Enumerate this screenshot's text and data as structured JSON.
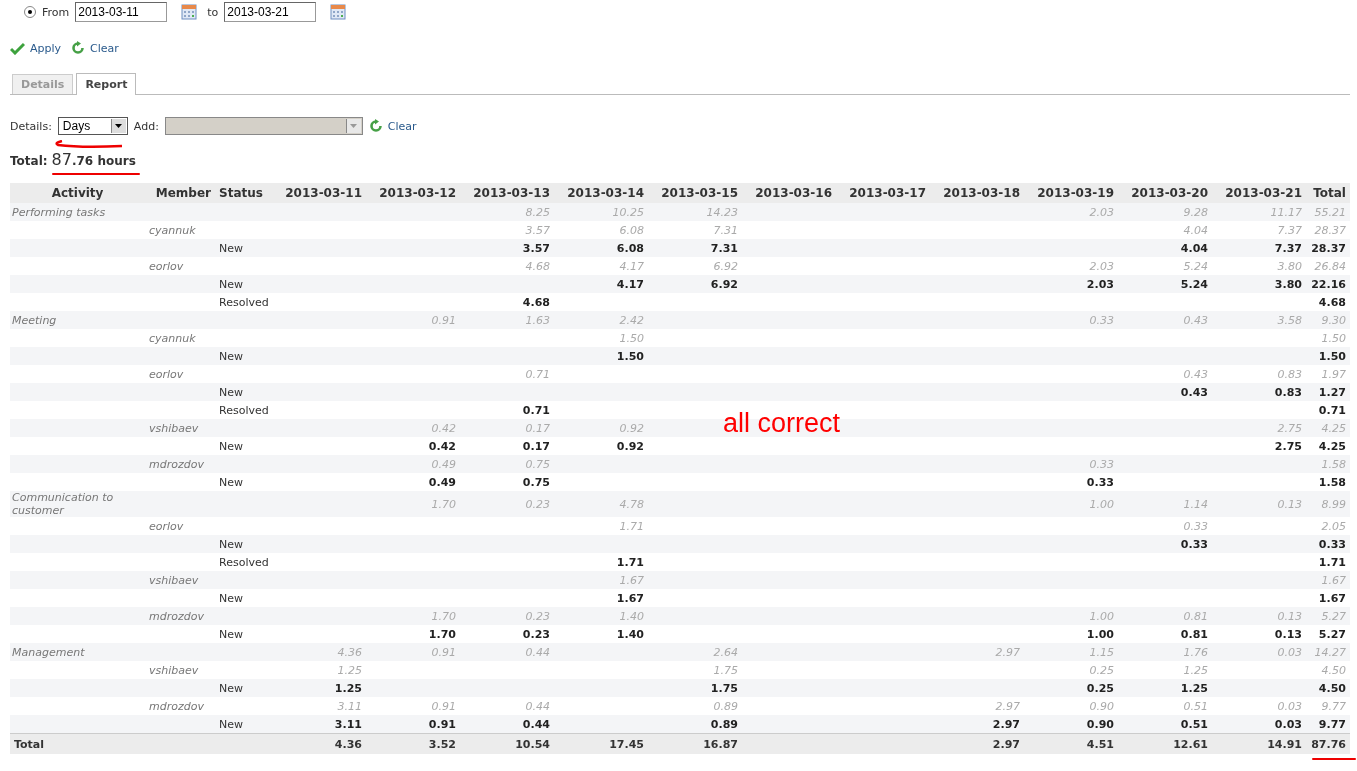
{
  "period": {
    "selected": true,
    "from_label": "From",
    "from": "2013-03-11",
    "to_label": "to",
    "to": "2013-03-21"
  },
  "actions": [
    {
      "kind": "apply",
      "label": "Apply"
    },
    {
      "kind": "clear",
      "label": "Clear"
    }
  ],
  "tabs": [
    {
      "label": "Details",
      "selected": false
    },
    {
      "label": "Report",
      "selected": true
    }
  ],
  "controls": {
    "details_label": "Details:",
    "details_value": "Days",
    "add_label": "Add:",
    "clear": "Clear"
  },
  "total": {
    "label": "Total:",
    "value": "87",
    "rest": ".76 hours"
  },
  "annotation": "all correct",
  "table": {
    "columns": [
      "Activity",
      "Member",
      "Status",
      "2013-03-11",
      "2013-03-12",
      "2013-03-13",
      "2013-03-14",
      "2013-03-15",
      "2013-03-16",
      "2013-03-17",
      "2013-03-18",
      "2013-03-19",
      "2013-03-20",
      "2013-03-21",
      "Total"
    ],
    "rows": [
      {
        "kind": "activity",
        "cells": [
          "Performing tasks",
          "",
          "",
          "",
          "",
          "8.25",
          "10.25",
          "14.23",
          "",
          "",
          "",
          "2.03",
          "9.28",
          "11.17",
          "55.21"
        ]
      },
      {
        "kind": "member",
        "cells": [
          "",
          "cyannuk",
          "",
          "",
          "",
          "3.57",
          "6.08",
          "7.31",
          "",
          "",
          "",
          "",
          "4.04",
          "7.37",
          "28.37"
        ]
      },
      {
        "kind": "status",
        "cells": [
          "",
          "",
          "New",
          "",
          "",
          "3.57",
          "6.08",
          "7.31",
          "",
          "",
          "",
          "",
          "4.04",
          "7.37",
          "28.37"
        ]
      },
      {
        "kind": "member",
        "cells": [
          "",
          "eorlov",
          "",
          "",
          "",
          "4.68",
          "4.17",
          "6.92",
          "",
          "",
          "",
          "2.03",
          "5.24",
          "3.80",
          "26.84"
        ]
      },
      {
        "kind": "status",
        "cells": [
          "",
          "",
          "New",
          "",
          "",
          "",
          "4.17",
          "6.92",
          "",
          "",
          "",
          "2.03",
          "5.24",
          "3.80",
          "22.16"
        ]
      },
      {
        "kind": "status",
        "cells": [
          "",
          "",
          "Resolved",
          "",
          "",
          "4.68",
          "",
          "",
          "",
          "",
          "",
          "",
          "",
          "",
          "4.68"
        ]
      },
      {
        "kind": "activity",
        "cells": [
          "Meeting",
          "",
          "",
          "",
          "0.91",
          "1.63",
          "2.42",
          "",
          "",
          "",
          "",
          "0.33",
          "0.43",
          "3.58",
          "9.30"
        ]
      },
      {
        "kind": "member",
        "cells": [
          "",
          "cyannuk",
          "",
          "",
          "",
          "",
          "1.50",
          "",
          "",
          "",
          "",
          "",
          "",
          "",
          "1.50"
        ]
      },
      {
        "kind": "status",
        "cells": [
          "",
          "",
          "New",
          "",
          "",
          "",
          "1.50",
          "",
          "",
          "",
          "",
          "",
          "",
          "",
          "1.50"
        ]
      },
      {
        "kind": "member",
        "cells": [
          "",
          "eorlov",
          "",
          "",
          "",
          "0.71",
          "",
          "",
          "",
          "",
          "",
          "",
          "0.43",
          "0.83",
          "1.97"
        ]
      },
      {
        "kind": "status",
        "cells": [
          "",
          "",
          "New",
          "",
          "",
          "",
          "",
          "",
          "",
          "",
          "",
          "",
          "0.43",
          "0.83",
          "1.27"
        ]
      },
      {
        "kind": "status",
        "cells": [
          "",
          "",
          "Resolved",
          "",
          "",
          "0.71",
          "",
          "",
          "",
          "",
          "",
          "",
          "",
          "",
          "0.71"
        ]
      },
      {
        "kind": "member",
        "cells": [
          "",
          "vshibaev",
          "",
          "",
          "0.42",
          "0.17",
          "0.92",
          "",
          "",
          "",
          "",
          "",
          "",
          "2.75",
          "4.25"
        ]
      },
      {
        "kind": "status",
        "cells": [
          "",
          "",
          "New",
          "",
          "0.42",
          "0.17",
          "0.92",
          "",
          "",
          "",
          "",
          "",
          "",
          "2.75",
          "4.25"
        ]
      },
      {
        "kind": "member",
        "cells": [
          "",
          "mdrozdov",
          "",
          "",
          "0.49",
          "0.75",
          "",
          "",
          "",
          "",
          "",
          "0.33",
          "",
          "",
          "1.58"
        ]
      },
      {
        "kind": "status",
        "cells": [
          "",
          "",
          "New",
          "",
          "0.49",
          "0.75",
          "",
          "",
          "",
          "",
          "",
          "0.33",
          "",
          "",
          "1.58"
        ]
      },
      {
        "kind": "activity",
        "cells": [
          "Communication to customer",
          "",
          "",
          "",
          "1.70",
          "0.23",
          "4.78",
          "",
          "",
          "",
          "",
          "1.00",
          "1.14",
          "0.13",
          "8.99"
        ]
      },
      {
        "kind": "member",
        "cells": [
          "",
          "eorlov",
          "",
          "",
          "",
          "",
          "1.71",
          "",
          "",
          "",
          "",
          "",
          "0.33",
          "",
          "2.05"
        ]
      },
      {
        "kind": "status",
        "cells": [
          "",
          "",
          "New",
          "",
          "",
          "",
          "",
          "",
          "",
          "",
          "",
          "",
          "0.33",
          "",
          "0.33"
        ]
      },
      {
        "kind": "status",
        "cells": [
          "",
          "",
          "Resolved",
          "",
          "",
          "",
          "1.71",
          "",
          "",
          "",
          "",
          "",
          "",
          "",
          "1.71"
        ]
      },
      {
        "kind": "member",
        "cells": [
          "",
          "vshibaev",
          "",
          "",
          "",
          "",
          "1.67",
          "",
          "",
          "",
          "",
          "",
          "",
          "",
          "1.67"
        ]
      },
      {
        "kind": "status",
        "cells": [
          "",
          "",
          "New",
          "",
          "",
          "",
          "1.67",
          "",
          "",
          "",
          "",
          "",
          "",
          "",
          "1.67"
        ]
      },
      {
        "kind": "member",
        "cells": [
          "",
          "mdrozdov",
          "",
          "",
          "1.70",
          "0.23",
          "1.40",
          "",
          "",
          "",
          "",
          "1.00",
          "0.81",
          "0.13",
          "5.27"
        ]
      },
      {
        "kind": "status",
        "cells": [
          "",
          "",
          "New",
          "",
          "1.70",
          "0.23",
          "1.40",
          "",
          "",
          "",
          "",
          "1.00",
          "0.81",
          "0.13",
          "5.27"
        ]
      },
      {
        "kind": "activity",
        "cells": [
          "Management",
          "",
          "",
          "4.36",
          "0.91",
          "0.44",
          "",
          "2.64",
          "",
          "",
          "2.97",
          "1.15",
          "1.76",
          "0.03",
          "14.27"
        ]
      },
      {
        "kind": "member",
        "cells": [
          "",
          "vshibaev",
          "",
          "1.25",
          "",
          "",
          "",
          "1.75",
          "",
          "",
          "",
          "0.25",
          "1.25",
          "",
          "4.50"
        ]
      },
      {
        "kind": "status",
        "cells": [
          "",
          "",
          "New",
          "1.25",
          "",
          "",
          "",
          "1.75",
          "",
          "",
          "",
          "0.25",
          "1.25",
          "",
          "4.50"
        ]
      },
      {
        "kind": "member",
        "cells": [
          "",
          "mdrozdov",
          "",
          "3.11",
          "0.91",
          "0.44",
          "",
          "0.89",
          "",
          "",
          "2.97",
          "0.90",
          "0.51",
          "0.03",
          "9.77"
        ]
      },
      {
        "kind": "status",
        "cells": [
          "",
          "",
          "New",
          "3.11",
          "0.91",
          "0.44",
          "",
          "0.89",
          "",
          "",
          "2.97",
          "0.90",
          "0.51",
          "0.03",
          "9.77"
        ]
      },
      {
        "kind": "total",
        "cells": [
          "Total",
          "",
          "",
          "4.36",
          "3.52",
          "10.54",
          "17.45",
          "16.87",
          "",
          "",
          "2.97",
          "4.51",
          "12.61",
          "14.91",
          "87.76"
        ]
      }
    ]
  }
}
